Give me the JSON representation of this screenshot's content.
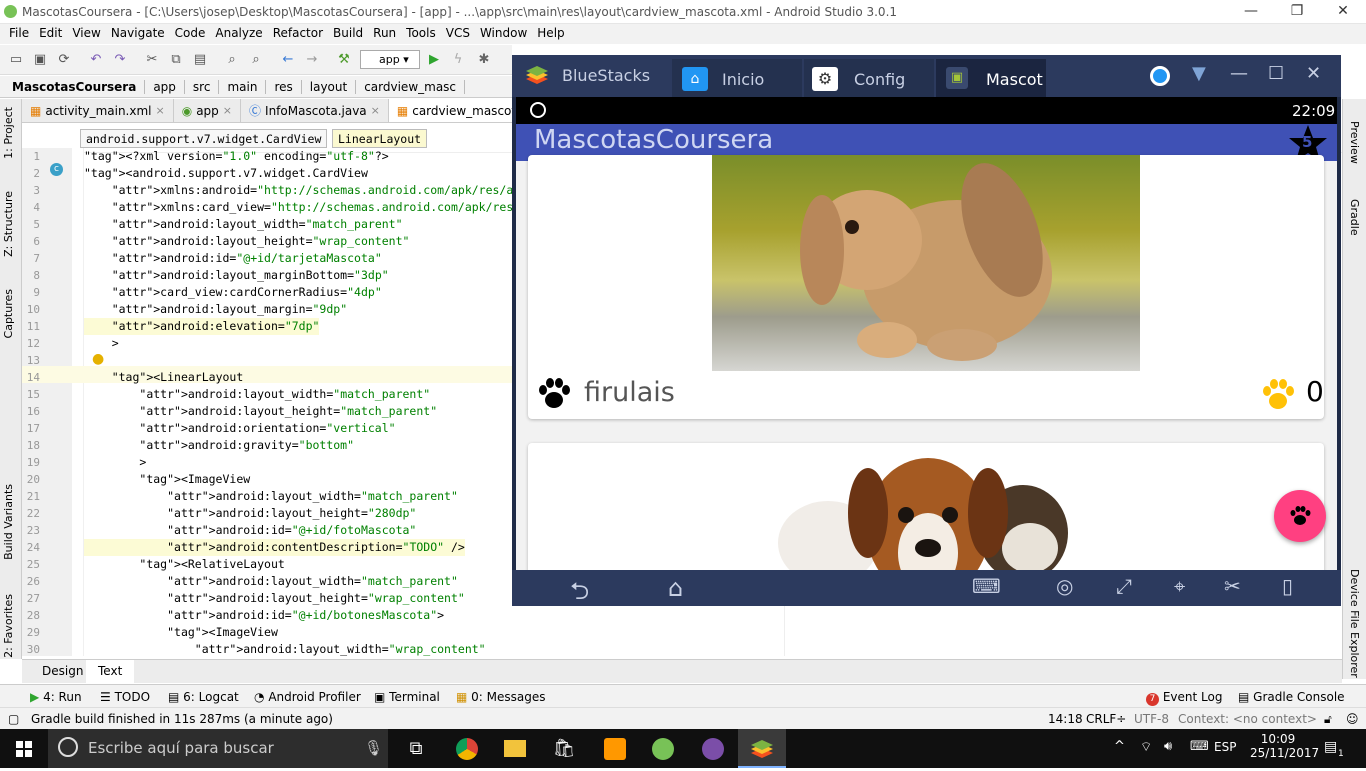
{
  "window": {
    "title": "MascotasCoursera - [C:\\Users\\josep\\Desktop\\MascotasCoursera] - [app] - ...\\app\\src\\main\\res\\layout\\cardview_mascota.xml - Android Studio 3.0.1"
  },
  "menu": [
    "File",
    "Edit",
    "View",
    "Navigate",
    "Code",
    "Analyze",
    "Refactor",
    "Build",
    "Run",
    "Tools",
    "VCS",
    "Window",
    "Help"
  ],
  "toolbar": {
    "run_config": "app"
  },
  "breadcrumb": [
    "MascotasCoursera",
    "app",
    "src",
    "main",
    "res",
    "layout",
    "cardview_masc"
  ],
  "editor_tabs": [
    {
      "label": "activity_main.xml",
      "active": false
    },
    {
      "label": "app",
      "active": false
    },
    {
      "label": "InfoMascota.java",
      "active": false
    },
    {
      "label": "cardview_mascota.xm",
      "active": true
    }
  ],
  "element_path": [
    "android.support.v7.widget.CardView",
    "LinearLayout"
  ],
  "left_tools": [
    "1: Project",
    "Z: Structure",
    "Captures",
    "Build Variants",
    "2: Favorites"
  ],
  "right_tools": [
    "Preview",
    "Gradle",
    "Device File Explorer"
  ],
  "code_lines": [
    {
      "n": "1",
      "text": "<?xml version=\"1.0\" encoding=\"utf-8\"?>"
    },
    {
      "n": "2",
      "text": "<android.support.v7.widget.CardView"
    },
    {
      "n": "3",
      "text": "    xmlns:android=\"http://schemas.android.com/apk/res/android\""
    },
    {
      "n": "4",
      "text": "    xmlns:card_view=\"http://schemas.android.com/apk/res-auto\""
    },
    {
      "n": "5",
      "text": "    android:layout_width=\"match_parent\""
    },
    {
      "n": "6",
      "text": "    android:layout_height=\"wrap_content\""
    },
    {
      "n": "7",
      "text": "    android:id=\"@+id/tarjetaMascota\""
    },
    {
      "n": "8",
      "text": "    android:layout_marginBottom=\"3dp\""
    },
    {
      "n": "9",
      "text": "    card_view:cardCornerRadius=\"4dp\""
    },
    {
      "n": "10",
      "text": "    android:layout_margin=\"9dp\""
    },
    {
      "n": "11",
      "text": "    android:elevation=\"7dp\""
    },
    {
      "n": "12",
      "text": "    >"
    },
    {
      "n": "13",
      "text": ""
    },
    {
      "n": "14",
      "text": "    <LinearLayout"
    },
    {
      "n": "15",
      "text": "        android:layout_width=\"match_parent\""
    },
    {
      "n": "16",
      "text": "        android:layout_height=\"match_parent\""
    },
    {
      "n": "17",
      "text": "        android:orientation=\"vertical\""
    },
    {
      "n": "18",
      "text": "        android:gravity=\"bottom\""
    },
    {
      "n": "19",
      "text": "        >"
    },
    {
      "n": "20",
      "text": "        <ImageView"
    },
    {
      "n": "21",
      "text": "            android:layout_width=\"match_parent\""
    },
    {
      "n": "22",
      "text": "            android:layout_height=\"280dp\""
    },
    {
      "n": "23",
      "text": "            android:id=\"@+id/fotoMascota\""
    },
    {
      "n": "24",
      "text": "            android:contentDescription=\"TODO\" />"
    },
    {
      "n": "25",
      "text": "        <RelativeLayout"
    },
    {
      "n": "26",
      "text": "            android:layout_width=\"match_parent\""
    },
    {
      "n": "27",
      "text": "            android:layout_height=\"wrap_content\""
    },
    {
      "n": "28",
      "text": "            android:id=\"@+id/botonesMascota\">"
    },
    {
      "n": "29",
      "text": "            <ImageView"
    },
    {
      "n": "30",
      "text": "                android:layout_width=\"wrap_content\""
    }
  ],
  "design_tabs": [
    "Design",
    "Text"
  ],
  "tool_windows": [
    "4: Run",
    "TODO",
    "6: Logcat",
    "Android Profiler",
    "Terminal",
    "0: Messages"
  ],
  "tool_windows_right": [
    "Event Log",
    "Gradle Console"
  ],
  "event_log_count": "7",
  "status": {
    "message": "Gradle build finished in 11s 287ms (a minute ago)",
    "position": "14:18",
    "line_sep": "CRLF÷",
    "encoding": "UTF-8",
    "context": "Context: <no context>"
  },
  "bluestacks": {
    "brand": "BlueStacks",
    "tabs": [
      "Inicio",
      "Config",
      "Mascot"
    ],
    "android_time": "22:09",
    "app_title": "MascotasCoursera",
    "star_count": "5",
    "pet_name": "firulais",
    "like_count": "0"
  },
  "taskbar": {
    "search_placeholder": "Escribe aquí para buscar",
    "language": "ESP",
    "time": "10:09",
    "date": "25/11/2017",
    "notifications": "1"
  },
  "colors": {
    "android_primary": "#3f51b5",
    "fab_accent": "#ff4081",
    "paw_yellow": "#ffc107",
    "bluestacks_chrome": "#2c3a5e"
  }
}
